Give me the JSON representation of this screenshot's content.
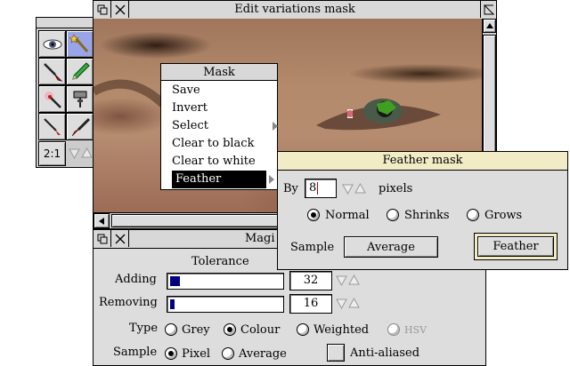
{
  "editor": {
    "title": "Edit variations mask"
  },
  "toolbox": {
    "zoom_label": "2:1"
  },
  "mask_menu": {
    "title": "Mask",
    "items": [
      {
        "label": "Save"
      },
      {
        "label": "Invert"
      },
      {
        "label": "Select",
        "submenu": true
      },
      {
        "label": "Clear to black"
      },
      {
        "label": "Clear to white"
      },
      {
        "label": "Feather",
        "submenu": true,
        "selected": true
      }
    ]
  },
  "feather_mask": {
    "title": "Feather mask",
    "by_label": "By",
    "by_value": "8",
    "pixels_label": "pixels",
    "modes": [
      "Normal",
      "Shrinks",
      "Grows"
    ],
    "selected_mode": "Normal",
    "sample_label": "Sample",
    "sample_value": "Average",
    "feather_button": "Feather"
  },
  "magic_window": {
    "title": "Magi",
    "tolerance_label": "Tolerance",
    "adding_label": "Adding",
    "adding_value": "32",
    "adding_fraction": 0.09,
    "removing_label": "Removing",
    "removing_value": "16",
    "removing_fraction": 0.04,
    "type_label": "Type",
    "types": [
      "Grey",
      "Colour",
      "Weighted",
      "HSV"
    ],
    "selected_type": "Colour",
    "sample_label": "Sample",
    "samples": [
      "Pixel",
      "Average"
    ],
    "selected_sample": "Pixel",
    "antialiased_label": "Anti-aliased",
    "antialiased_checked": false
  },
  "colors": {
    "window_grey": "#dddddd",
    "title_cream": "#f2ecc6",
    "menu_highlight": "#000000",
    "slider_fill": "#000080",
    "mask_green": "#3fa020"
  }
}
